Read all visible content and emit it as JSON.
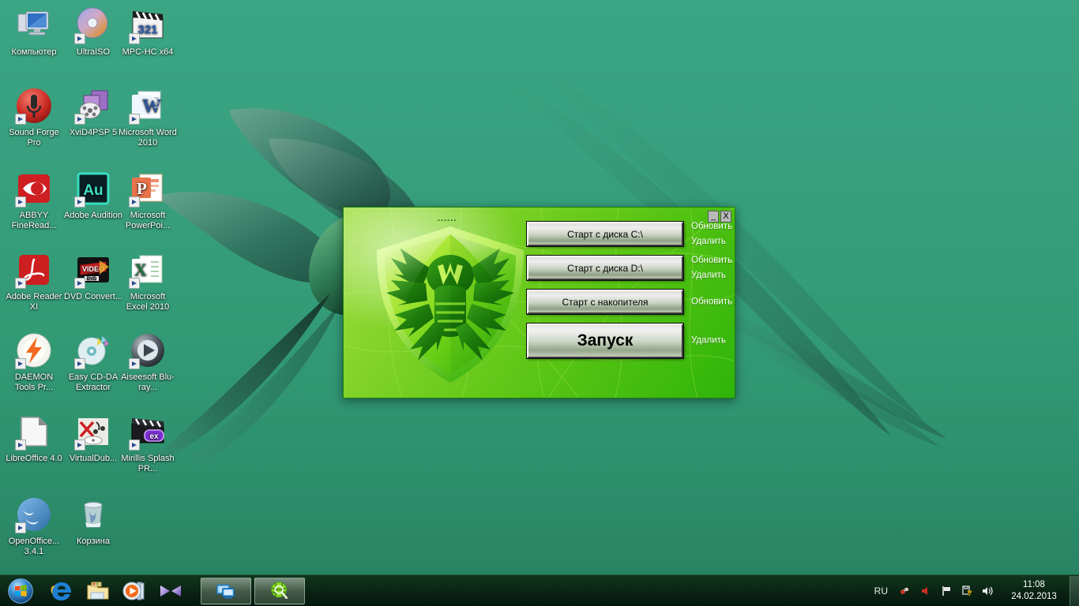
{
  "desktop": {
    "background_top": "#3ba583",
    "background_bottom": "#27805f",
    "wallpaper_name": "hummingbird-wallpaper",
    "icons": [
      {
        "label": "Компьютер",
        "icon": "computer-icon",
        "shortcut": false
      },
      {
        "label": "UltraISO",
        "icon": "ultraiso-disc-icon",
        "shortcut": true
      },
      {
        "label": "MPC-HC x64",
        "icon": "mpc-hc-clapper-icon",
        "shortcut": true
      },
      {
        "label": "Sound Forge Pro",
        "icon": "sound-forge-mic-icon",
        "shortcut": true
      },
      {
        "label": "XviD4PSP 5",
        "icon": "xvid4psp-film-icon",
        "shortcut": true
      },
      {
        "label": "Microsoft Word 2010",
        "icon": "word-icon",
        "shortcut": true
      },
      {
        "label": "ABBYY FineRead...",
        "icon": "abbyy-eye-icon",
        "shortcut": true
      },
      {
        "label": "Adobe Audition",
        "icon": "adobe-audition-icon",
        "shortcut": true
      },
      {
        "label": "Microsoft PowerPoi...",
        "icon": "powerpoint-icon",
        "shortcut": true
      },
      {
        "label": "Adobe Reader XI",
        "icon": "adobe-reader-icon",
        "shortcut": true
      },
      {
        "label": "DVD Convert...",
        "icon": "dvd-converter-icon",
        "shortcut": true
      },
      {
        "label": "Microsoft Excel 2010",
        "icon": "excel-icon",
        "shortcut": true
      },
      {
        "label": "DAEMON Tools Pr...",
        "icon": "daemon-tools-bolt-icon",
        "shortcut": true
      },
      {
        "label": "Easy CD-DA Extractor",
        "icon": "easy-cdda-disc-icon",
        "shortcut": true
      },
      {
        "label": "Aiseesoft Blu-ray...",
        "icon": "aiseesoft-play-icon",
        "shortcut": true
      },
      {
        "label": "LibreOffice 4.0",
        "icon": "libreoffice-doc-icon",
        "shortcut": true
      },
      {
        "label": "VirtualDub...",
        "icon": "virtualdub-icon",
        "shortcut": true
      },
      {
        "label": "Mirillis Splash PR...",
        "icon": "mirillis-splash-icon",
        "shortcut": true
      },
      {
        "label": "OpenOffice... 3.4.1",
        "icon": "openoffice-gulls-icon",
        "shortcut": true
      },
      {
        "label": "Корзина",
        "icon": "recycle-bin-icon",
        "shortcut": false
      }
    ]
  },
  "drweb_window": {
    "title_dots": "......",
    "logo_name": "drweb-spider-shield-logo",
    "window_controls": {
      "minimize": "_",
      "close": "X"
    },
    "accent_green_light": "#9ede3c",
    "accent_green_dark": "#2fb40a",
    "rows": [
      {
        "button_label": "Старт с диска C:\\",
        "button_name": "start-from-disk-c-button",
        "size": "normal",
        "side_labels": [
          "Обновить",
          "Удалить"
        ]
      },
      {
        "button_label": "Старт с диска D:\\",
        "button_name": "start-from-disk-d-button",
        "size": "normal",
        "side_labels": [
          "Обновить",
          "Удалить"
        ]
      },
      {
        "button_label": "Старт с накопителя",
        "button_name": "start-from-drive-button",
        "size": "normal",
        "side_labels": [
          "Обновить"
        ]
      },
      {
        "button_label": "Запуск",
        "button_name": "launch-button",
        "size": "big",
        "side_labels": [
          "Удалить"
        ]
      }
    ]
  },
  "taskbar": {
    "start_button": "start-orb",
    "quick_launch": [
      {
        "name": "internet-explorer-icon"
      },
      {
        "name": "windows-explorer-icon"
      },
      {
        "name": "windows-media-player-icon"
      },
      {
        "name": "media-center-icon"
      }
    ],
    "task_windows": [
      {
        "name": "remote-desktop-window-button"
      },
      {
        "name": "drweb-cureit-window-button"
      }
    ],
    "tray": {
      "language": "RU",
      "icons": [
        {
          "name": "bluetooth-devices-icon"
        },
        {
          "name": "speaker-red-icon"
        },
        {
          "name": "network-flag-icon"
        },
        {
          "name": "action-center-warning-icon"
        },
        {
          "name": "volume-icon"
        }
      ],
      "time": "11:08",
      "date": "24.02.2013"
    }
  }
}
